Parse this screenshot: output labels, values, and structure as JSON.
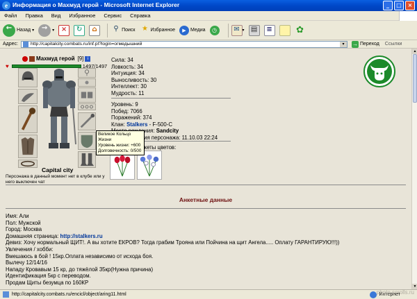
{
  "window": {
    "title": "Информация о Махмуд герой - Microsoft Internet Explorer",
    "buttons": [
      "_",
      "□",
      "×"
    ]
  },
  "menu": [
    "Файл",
    "Правка",
    "Вид",
    "Избранное",
    "Сервис",
    "Справка"
  ],
  "toolbar": {
    "back": "Назад",
    "search": "Поиск",
    "favorites": "Избранное",
    "media": "Медиа"
  },
  "address": {
    "label": "Адрес:",
    "url": "http://capitalcity.combats.ru/inf.pl?login=огмедышний",
    "go": "Переход",
    "links": "Ссылки"
  },
  "character": {
    "name": "Махмуд герой",
    "level": "[9]",
    "hp": "1497/1497",
    "hp_fraction": 1.0,
    "city": "Capital city",
    "status_note": "Персонажа в данный момент нет в клубе или у него выключен чат"
  },
  "stats": [
    "Сила: 34",
    "Ловкость: 34",
    "Интуиция: 34",
    "Выносливость: 30",
    "Интеллект: 30",
    "Мудрость: 11"
  ],
  "info": {
    "level": "Уровень: 9",
    "wins": "Побед: 7066",
    "losses": "Поражений: 374",
    "clan_label": "Клан: ",
    "clan_name": "Stalkers",
    "clan_suffix": " - F-500-C",
    "birthplace_label": "Место рождения: ",
    "birthplace": "Sandcity",
    "birthday": "День рождения персонажа: 11.10.03 22:24",
    "flowers": "Подарены букеты цветов:"
  },
  "tooltip": {
    "line1": "Великое Кольцо Жизни",
    "line2": "Уровень жизни: +600",
    "line3": "Долговечность: 0/500"
  },
  "section_title": "Анкетные данные",
  "profile": {
    "lines": [
      "Имя: Али",
      "Пол: Мужской",
      "Город: Москва"
    ],
    "homepage_label": "Домашняя страница: ",
    "homepage": "http://stalkers.ru",
    "motto": "Девиз: Хочу нормальный ЩИТ!. А вы хотите ЕКРОВ? Тогда грабим Трояна или Пойчина на щит Ангела..... Оплату ГАРАНТИРУЮ!!!))",
    "hobby_lines": [
      "Увлечения / хобби:",
      "Вмешаюсь в бой ! 15кр.Оплата независимо от исхода боя.",
      "Вылечу 12/14/16",
      "Нападу Кровавым 15 кр, до тяжёлой 35кр(Нужна причина)",
      "Идентификация 5кр с переводом.",
      "Продам Щиты безумца по 160КР"
    ]
  },
  "statusbar": {
    "url": "http://capitalcity.combats.ru/encicl/object/aring11.html",
    "zone": "Интернет"
  },
  "watermark": "photo.scrolls.ru"
}
